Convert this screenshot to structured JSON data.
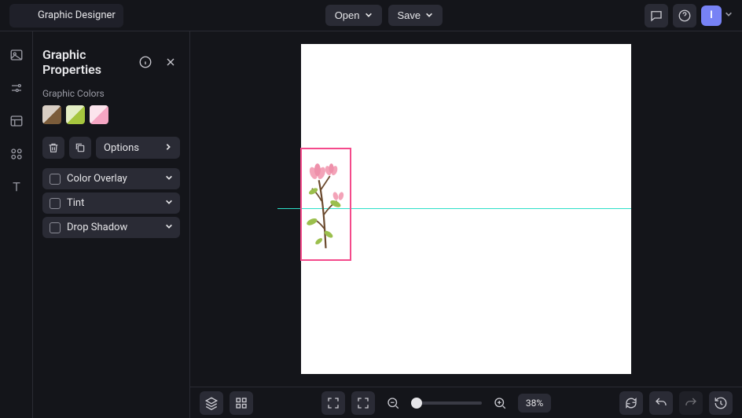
{
  "header": {
    "app_title": "Graphic Designer",
    "open_label": "Open",
    "save_label": "Save",
    "avatar_initial": "I"
  },
  "panel": {
    "title": "Graphic Properties",
    "colors_label": "Graphic Colors",
    "swatches": [
      "#7b5c3a",
      "#a6c63e",
      "#f5a6c3"
    ],
    "options_label": "Options",
    "props": [
      {
        "label": "Color Overlay"
      },
      {
        "label": "Tint"
      },
      {
        "label": "Drop Shadow"
      }
    ]
  },
  "rail": {
    "tools": [
      "photo-icon",
      "sliders-icon",
      "grid-icon",
      "components-icon",
      "text-icon"
    ]
  },
  "canvas": {
    "selection_color": "#f44a8b",
    "guide_color": "#2de0c8"
  },
  "bottombar": {
    "zoom_pct": "38%"
  }
}
